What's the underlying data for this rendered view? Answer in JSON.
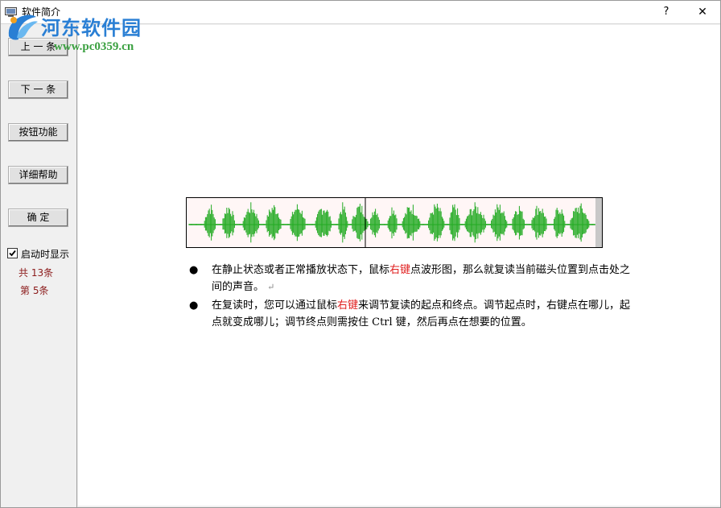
{
  "window": {
    "title": "软件简介",
    "help_label": "?",
    "close_label": "✕"
  },
  "watermark": {
    "site_name": "河东软件园",
    "url": "www.pc0359.cn"
  },
  "sidebar": {
    "buttons": [
      {
        "label": "上 一 条"
      },
      {
        "label": "下 一 条"
      },
      {
        "label": "按钮功能"
      },
      {
        "label": "详细帮助"
      },
      {
        "label": "确   定"
      }
    ],
    "startup_checkbox": {
      "label": "启动时显示",
      "checked": true
    },
    "total_count": "共 13条",
    "current_index": "第 5条"
  },
  "content": {
    "bullets": [
      {
        "before": "在静止状态或者正常播放状态下，鼠标",
        "highlight": "右键",
        "after": "点波形图，那么就复读当前磁头位置到点击处之间的声音。",
        "para_mark": "↵"
      },
      {
        "before": "在复读时，您可以通过鼠标",
        "highlight": "右键",
        "after": "来调节复读的起点和终点。调节起点时，右键点在哪儿，起点就变成哪儿；调节终点则需按住 Ctrl 键，然后再点在想要的位置。",
        "para_mark": ""
      }
    ],
    "colors": {
      "waveform": "#22aa22",
      "highlight": "#e02020"
    }
  }
}
